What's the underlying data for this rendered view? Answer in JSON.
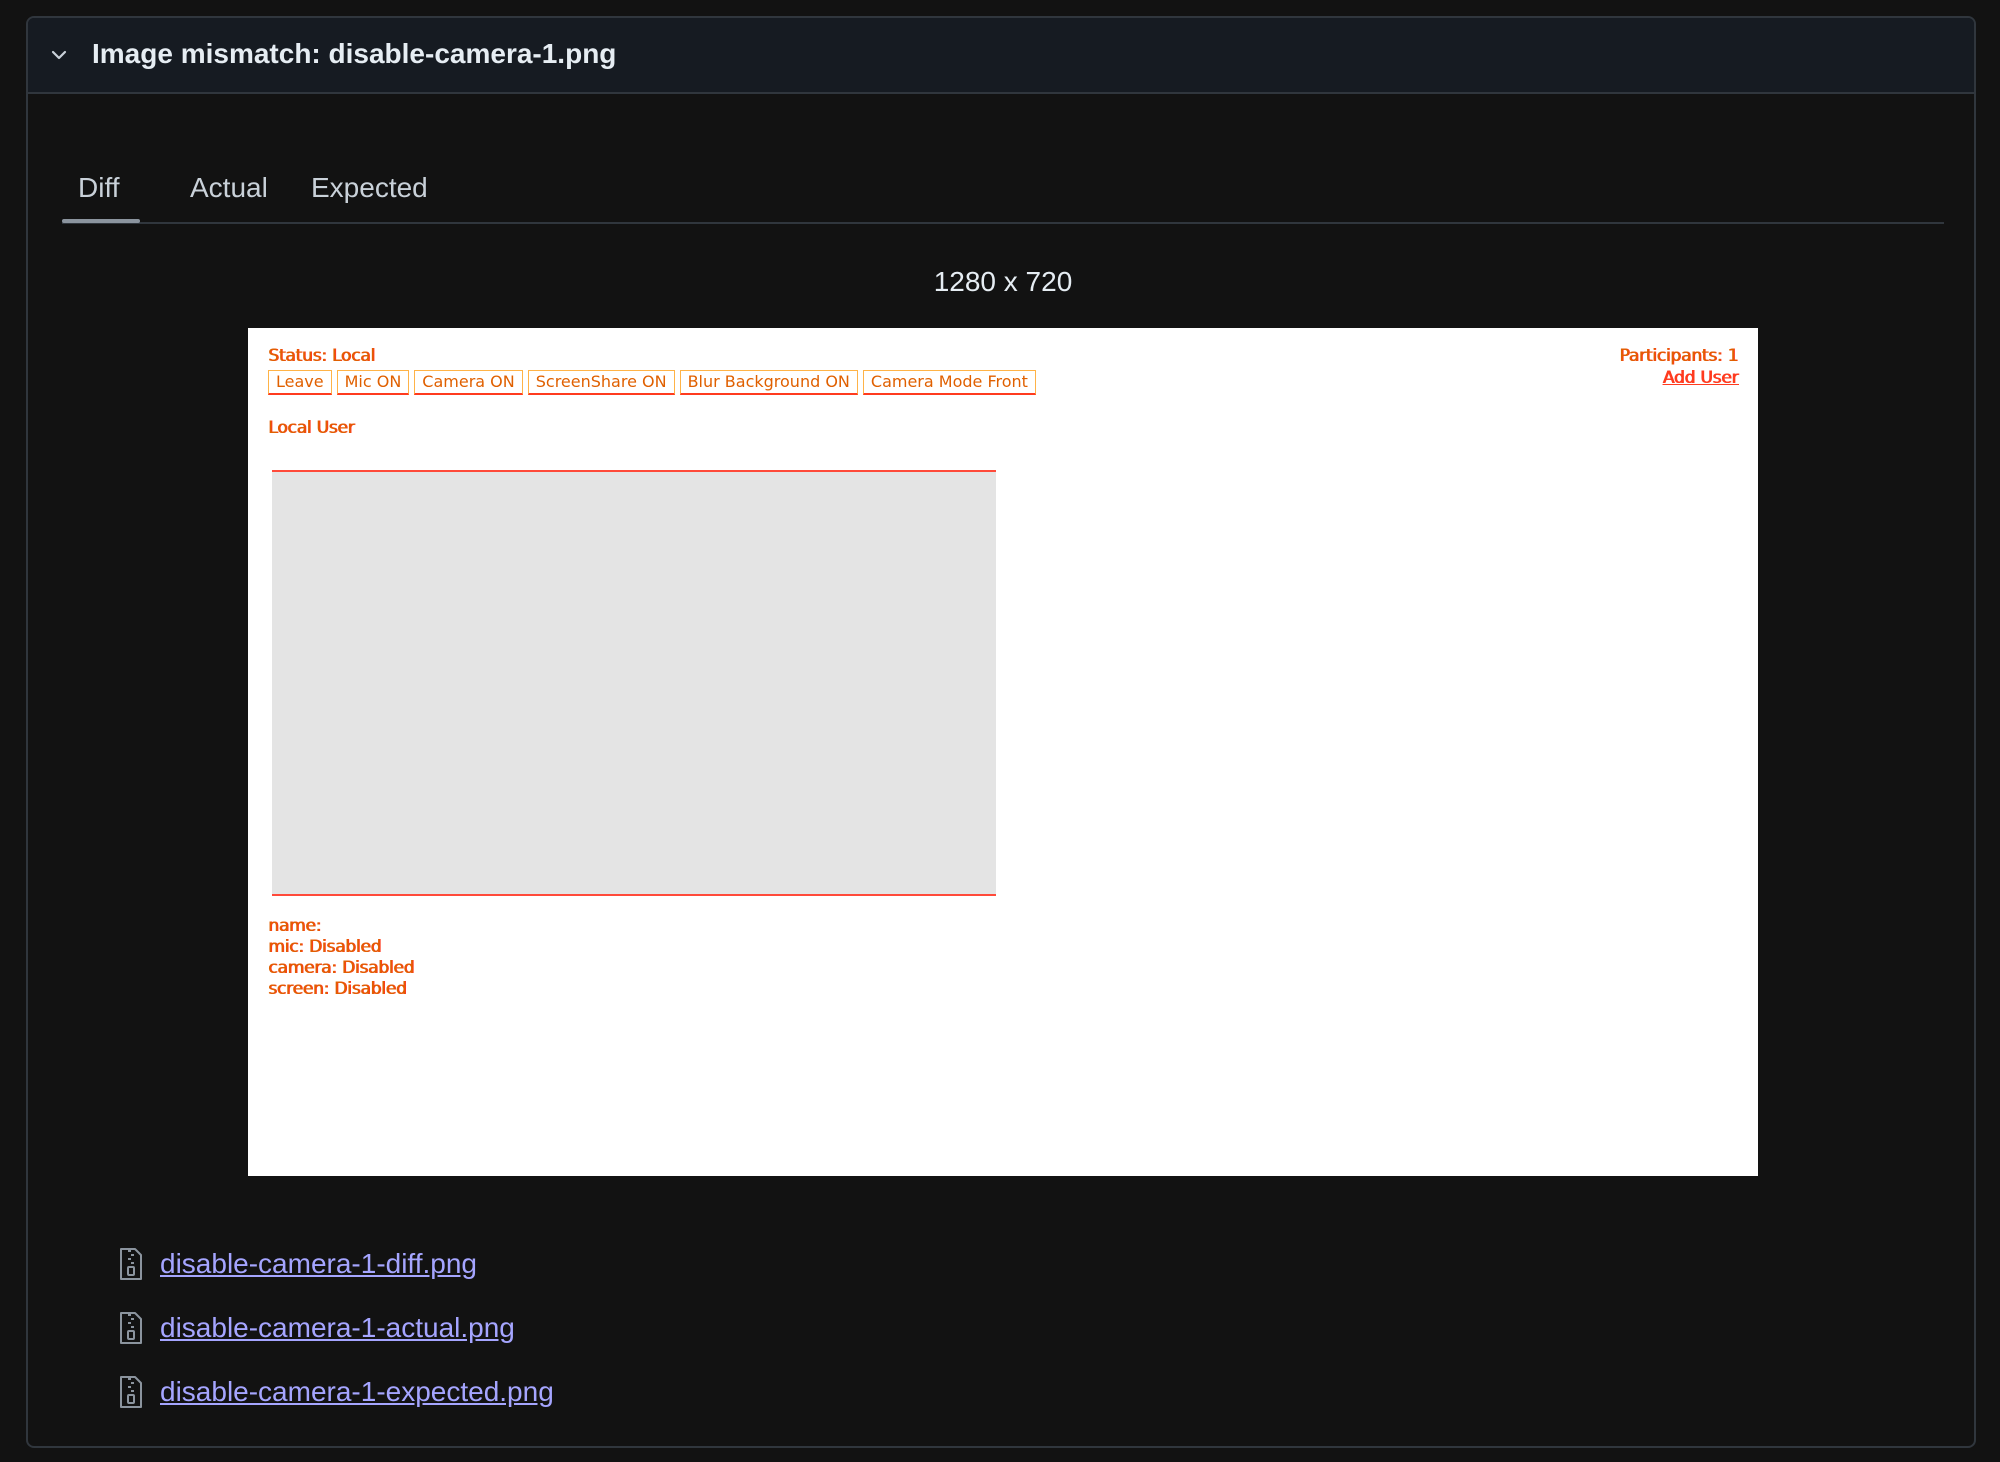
{
  "header": {
    "title": "Image mismatch: disable-camera-1.png",
    "chevron_icon": "chevron-down-icon"
  },
  "tabs": [
    {
      "label": "Diff",
      "selected": true
    },
    {
      "label": "Actual",
      "selected": false
    },
    {
      "label": "Expected",
      "selected": false
    }
  ],
  "image": {
    "dimensions_label": "1280 x 720",
    "content": {
      "status": "Status: Local",
      "buttons": [
        "Leave",
        "Mic ON",
        "Camera ON",
        "ScreenShare ON",
        "Blur Background ON",
        "Camera Mode Front"
      ],
      "participants": "Participants: 1",
      "add_user": "Add User",
      "local_user": "Local User",
      "info_lines": [
        "name:",
        "mic: Disabled",
        "camera: Disabled",
        "screen: Disabled"
      ]
    },
    "colors": {
      "diff_primary": "#ff3b1f",
      "diff_secondary": "#ffb347",
      "placeholder": "#e4e4e4"
    }
  },
  "attachments": [
    {
      "name": "disable-camera-1-diff.png",
      "icon": "zip-file-icon"
    },
    {
      "name": "disable-camera-1-actual.png",
      "icon": "zip-file-icon"
    },
    {
      "name": "disable-camera-1-expected.png",
      "icon": "zip-file-icon"
    }
  ]
}
